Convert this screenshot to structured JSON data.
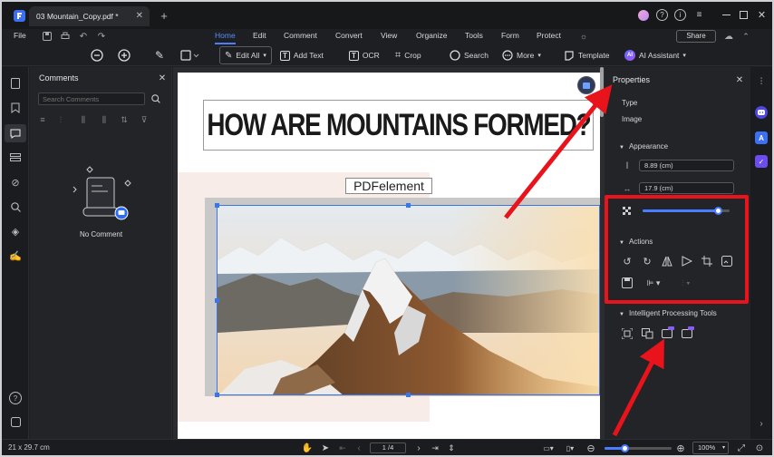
{
  "window": {
    "tab_title": "03 Mountain_Copy.pdf *",
    "file_menu": "File"
  },
  "menu": {
    "items": [
      "Home",
      "Edit",
      "Comment",
      "Convert",
      "View",
      "Organize",
      "Tools",
      "Form",
      "Protect"
    ],
    "active": "Home",
    "share_label": "Share"
  },
  "toolbar": {
    "edit_all": "Edit All",
    "add_text": "Add Text",
    "ocr": "OCR",
    "crop": "Crop",
    "search": "Search",
    "more": "More",
    "template": "Template",
    "ai_assistant": "AI Assistant"
  },
  "comments_panel": {
    "title": "Comments",
    "search_placeholder": "Search Comments",
    "empty_text": "No Comment"
  },
  "document": {
    "heading": "HOW ARE MOUNTAINS FORMED?",
    "image_caption_box": "PDFelement"
  },
  "properties": {
    "title": "Properties",
    "type_label": "Type",
    "type_value": "Image",
    "appearance_label": "Appearance",
    "height_value": "8.89 (cm)",
    "width_value": "17.9 (cm)",
    "opacity_fraction": 0.86,
    "actions_label": "Actions",
    "intelligent_label": "Intelligent Processing Tools"
  },
  "status": {
    "page_size": "21 x 29.7 cm",
    "page_indicator": "1 /4",
    "zoom_value": "100%",
    "zoom_fraction": 0.3
  },
  "colors": {
    "accent": "#4a7dff",
    "annotation_red": "#e8131b",
    "panel_bg": "#232428"
  },
  "icons": [
    "app-logo-icon",
    "minimize-icon",
    "maximize-icon",
    "close-icon",
    "zoom-out-icon",
    "zoom-in-icon",
    "highlight-icon",
    "shape-icon",
    "ocr-icon",
    "crop-icon",
    "search-icon",
    "more-icon",
    "template-icon",
    "ai-icon"
  ]
}
